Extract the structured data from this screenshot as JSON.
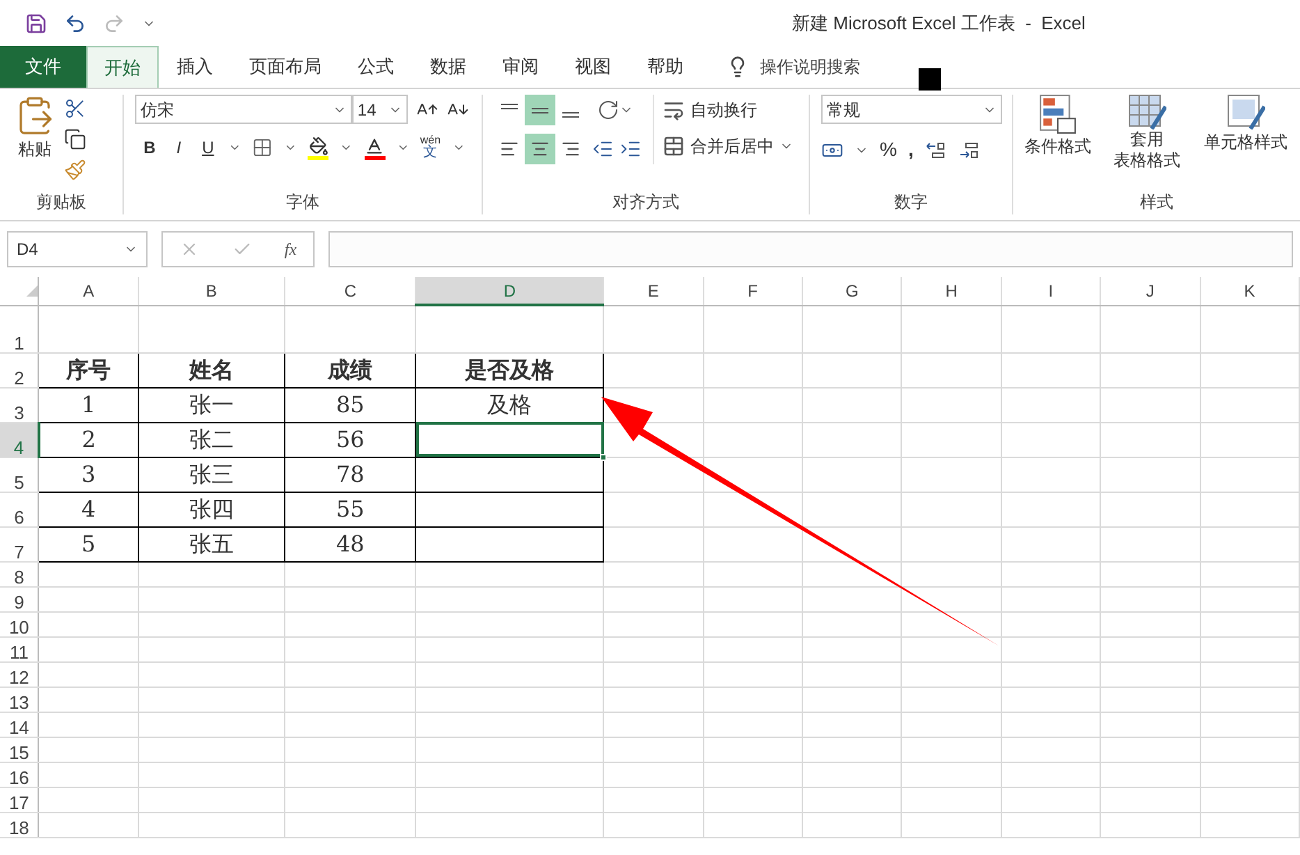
{
  "window": {
    "title": "新建 Microsoft Excel 工作表  -  Excel"
  },
  "file_menu": {
    "label": "文件"
  },
  "menu_tabs": [
    {
      "label": "开始",
      "kind": "tab",
      "selected": true
    },
    {
      "label": "插入",
      "kind": "tab",
      "selected": false
    },
    {
      "label": "页面布局",
      "kind": "tab",
      "selected": false
    },
    {
      "label": "公式",
      "kind": "tab",
      "selected": false
    },
    {
      "label": "数据",
      "kind": "tab",
      "selected": false
    },
    {
      "label": "审阅",
      "kind": "tab",
      "selected": false
    },
    {
      "label": "视图",
      "kind": "tab",
      "selected": false
    },
    {
      "label": "帮助",
      "kind": "tab",
      "selected": false
    }
  ],
  "tell_me": {
    "placeholder": "操作说明搜索"
  },
  "ribbon": {
    "clipboard": {
      "paste_label": "粘贴",
      "group_label": "剪贴板"
    },
    "font": {
      "font_name": "仿宋",
      "font_size": "14",
      "bold": "B",
      "italic": "I",
      "underline": "U",
      "phonetic_top": "wén",
      "phonetic_bottom": "文",
      "group_label": "字体"
    },
    "alignment": {
      "vertical": [
        {
          "kind": "top",
          "selected": false
        },
        {
          "kind": "middle",
          "selected": true
        },
        {
          "kind": "bottom",
          "selected": false
        }
      ],
      "horizontal": [
        {
          "kind": "left",
          "selected": false
        },
        {
          "kind": "center",
          "selected": true
        },
        {
          "kind": "right",
          "selected": false
        }
      ],
      "wrap_text": "自动换行",
      "merge_center": "合并后居中",
      "group_label": "对齐方式"
    },
    "number": {
      "format": "常规",
      "percent": "%",
      "comma": ",",
      "group_label": "数字"
    },
    "styles": {
      "conditional": "条件格式",
      "table_format": [
        "套用",
        "表格格式"
      ],
      "cell_styles": "单元格样式",
      "group_label": "样式"
    }
  },
  "name_box": {
    "value": "D4"
  },
  "formula_bar": {
    "fx": "fx"
  },
  "columns": [
    {
      "label": "A",
      "selected": false
    },
    {
      "label": "B",
      "selected": false
    },
    {
      "label": "C",
      "selected": false
    },
    {
      "label": "D",
      "selected": true
    },
    {
      "label": "E",
      "selected": false
    },
    {
      "label": "F",
      "selected": false
    },
    {
      "label": "G",
      "selected": false
    },
    {
      "label": "H",
      "selected": false
    },
    {
      "label": "I",
      "selected": false
    },
    {
      "label": "J",
      "selected": false
    },
    {
      "label": "K",
      "selected": false
    }
  ],
  "rows": [
    {
      "label": "1",
      "selected": false,
      "cells": []
    },
    {
      "label": "2",
      "selected": false,
      "cells": [
        {
          "value": "序号",
          "selected": false
        },
        {
          "value": "姓名",
          "selected": false
        },
        {
          "value": "成绩",
          "selected": false
        },
        {
          "value": "是否及格",
          "selected": false
        }
      ]
    },
    {
      "label": "3",
      "selected": false,
      "cells": [
        {
          "value": "1",
          "selected": false
        },
        {
          "value": "张一",
          "selected": false
        },
        {
          "value": "85",
          "selected": false
        },
        {
          "value": "及格",
          "selected": false
        }
      ]
    },
    {
      "label": "4",
      "selected": true,
      "cells": [
        {
          "value": "2",
          "selected": false
        },
        {
          "value": "张二",
          "selected": false
        },
        {
          "value": "56",
          "selected": false
        },
        {
          "selected": true
        }
      ]
    },
    {
      "label": "5",
      "selected": false,
      "cells": [
        {
          "value": "3",
          "selected": false
        },
        {
          "value": "张三",
          "selected": false
        },
        {
          "value": "78",
          "selected": false
        },
        {
          "selected": false
        }
      ]
    },
    {
      "label": "6",
      "selected": false,
      "cells": [
        {
          "value": "4",
          "selected": false
        },
        {
          "value": "张四",
          "selected": false
        },
        {
          "value": "55",
          "selected": false
        },
        {
          "selected": false
        }
      ]
    },
    {
      "label": "7",
      "selected": false,
      "cells": [
        {
          "value": "5",
          "selected": false
        },
        {
          "value": "张五",
          "selected": false
        },
        {
          "value": "48",
          "selected": false
        },
        {
          "selected": false
        }
      ]
    },
    {
      "label": "8",
      "selected": false,
      "cells": []
    },
    {
      "label": "9",
      "selected": false,
      "cells": []
    },
    {
      "label": "10",
      "selected": false,
      "cells": []
    },
    {
      "label": "11",
      "selected": false,
      "cells": []
    },
    {
      "label": "12",
      "selected": false,
      "cells": []
    },
    {
      "label": "13",
      "selected": false,
      "cells": []
    },
    {
      "label": "14",
      "selected": false,
      "cells": []
    },
    {
      "label": "15",
      "selected": false,
      "cells": []
    },
    {
      "label": "16",
      "selected": false,
      "cells": []
    },
    {
      "label": "17",
      "selected": false,
      "cells": []
    },
    {
      "label": "18",
      "selected": false,
      "cells": []
    }
  ]
}
